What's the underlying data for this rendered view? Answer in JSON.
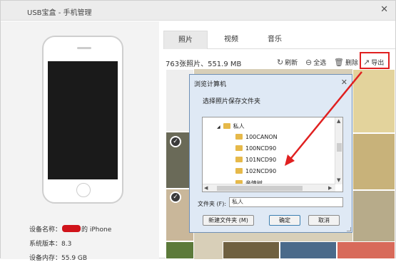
{
  "window": {
    "title": "USB宝盒 - 手机管理",
    "close": "✕"
  },
  "device": {
    "name_label": "设备名称：",
    "name_suffix": "的 iPhone",
    "version_label": "系统版本：",
    "version_value": "8.3",
    "memory_label": "设备内存：",
    "memory_value": "55.9 GB"
  },
  "tabs": [
    {
      "label": "照片"
    },
    {
      "label": "视频"
    },
    {
      "label": "音乐"
    }
  ],
  "summary": "763张照片、551.9 MB",
  "toolbar": {
    "refresh": "刷新",
    "refresh_icon": "↻",
    "select_all": "全选",
    "select_all_icon": "⊖",
    "delete": "删除",
    "delete_icon": "🗑",
    "export": "导出",
    "export_icon": "↗"
  },
  "dialog": {
    "title": "浏览计算机",
    "close": "✕",
    "prompt": "选择照片保存文件夹",
    "tree": [
      {
        "label": "私人"
      },
      {
        "label": "100CANON"
      },
      {
        "label": "100NCD90"
      },
      {
        "label": "101NCD90"
      },
      {
        "label": "102NCD90"
      },
      {
        "label": "亲情树"
      }
    ],
    "folder_label": "文件夹 (F):",
    "folder_value": "私人",
    "new_folder": "新建文件夹 (M)",
    "ok": "确定",
    "cancel": "取消"
  },
  "colors": {
    "accent_red": "#e02020",
    "screen": "#1a1a1a",
    "dialog_bg": "#dfe9f5"
  }
}
